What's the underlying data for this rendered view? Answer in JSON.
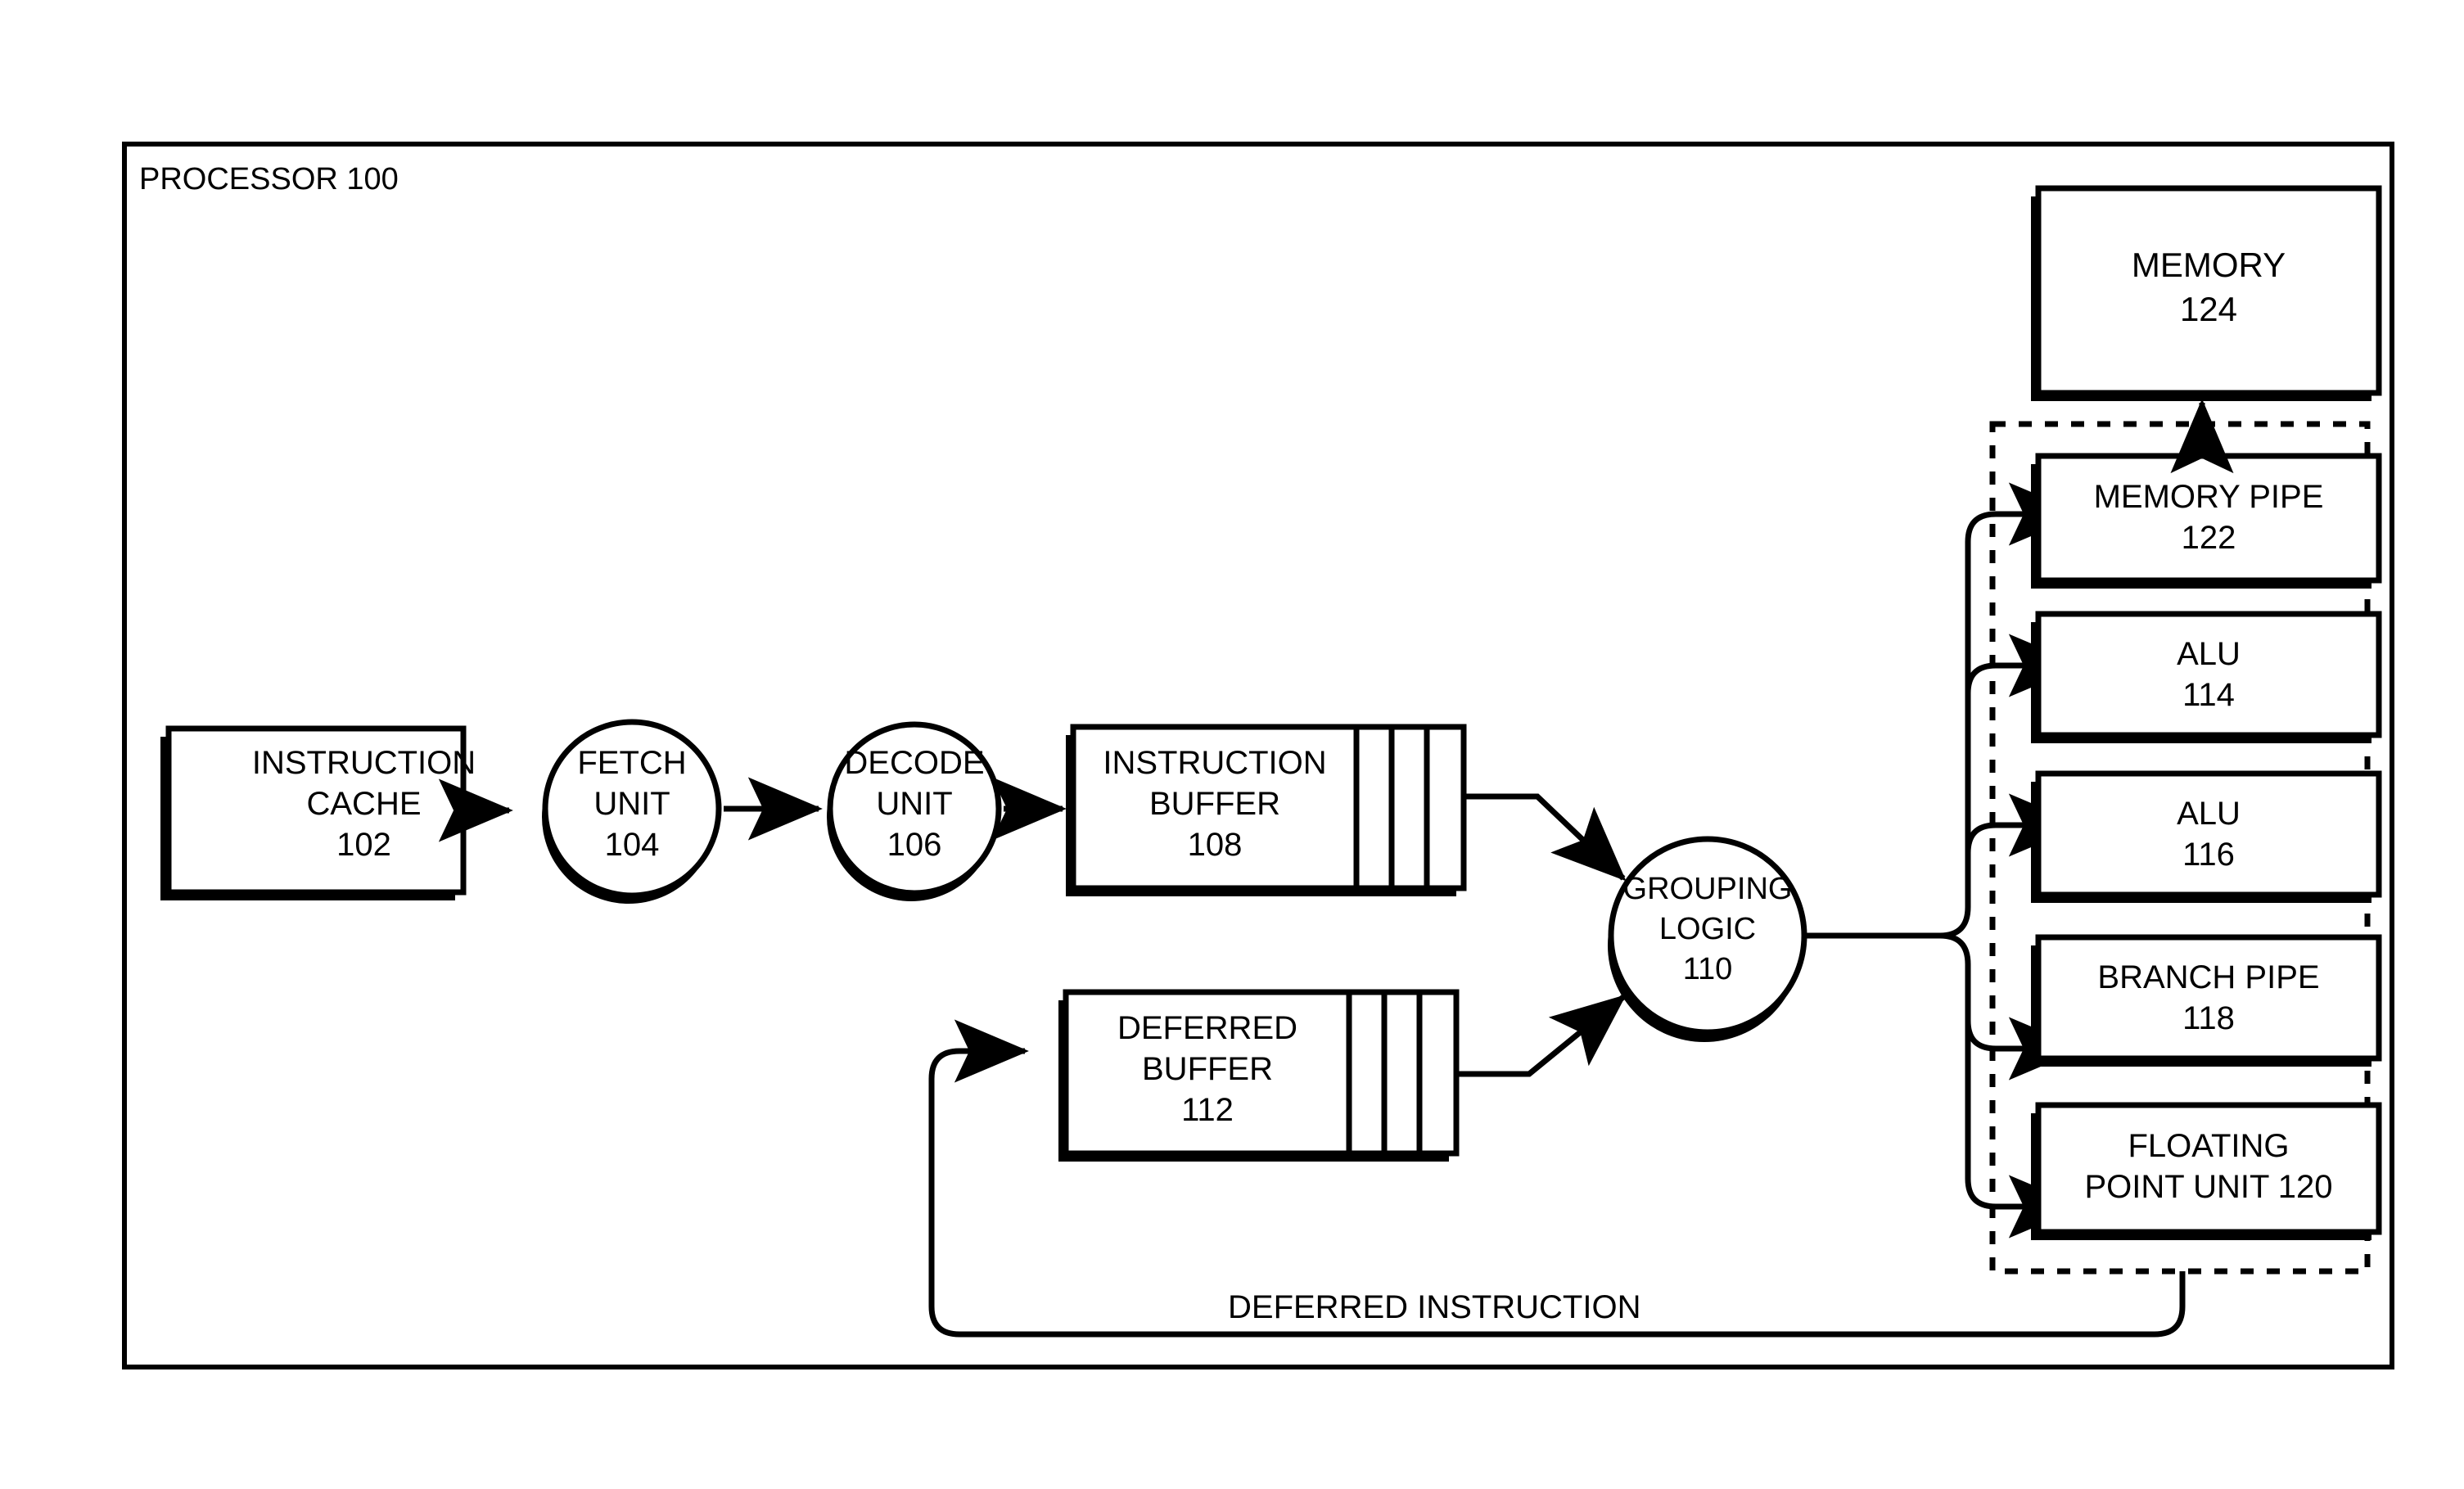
{
  "diagram": {
    "title": "PROCESSOR 100",
    "outer_block": {
      "label": "PROCESSOR 100",
      "ref": "100"
    },
    "blocks": [
      {
        "id": "instruction-cache",
        "shape": "box-shadow",
        "line1": "INSTRUCTION",
        "line2": "CACHE",
        "ref": "102"
      },
      {
        "id": "fetch-unit",
        "shape": "circle-shadow",
        "line1": "FETCH",
        "line2": "UNIT",
        "ref": "104"
      },
      {
        "id": "decode-unit",
        "shape": "circle-shadow",
        "line1": "DECODE",
        "line2": "UNIT",
        "ref": "106"
      },
      {
        "id": "instruction-buffer",
        "shape": "slotted-box-shadow",
        "line1": "INSTRUCTION",
        "line2": "BUFFER",
        "ref": "108",
        "slots": 3
      },
      {
        "id": "deferred-buffer",
        "shape": "slotted-box-shadow",
        "line1": "DEFERRED",
        "line2": "BUFFER",
        "ref": "112",
        "slots": 3
      },
      {
        "id": "grouping-logic",
        "shape": "circle-shadow",
        "line1": "GROUPING",
        "line2": "LOGIC",
        "ref": "110"
      },
      {
        "id": "memory-pipe",
        "shape": "box-shadow",
        "line1": "MEMORY PIPE",
        "ref": "122"
      },
      {
        "id": "alu-114",
        "shape": "box-shadow",
        "line1": "ALU",
        "ref": "114"
      },
      {
        "id": "alu-116",
        "shape": "box-shadow",
        "line1": "ALU",
        "ref": "116"
      },
      {
        "id": "branch-pipe",
        "shape": "box-shadow",
        "line1": "BRANCH PIPE",
        "ref": "118"
      },
      {
        "id": "floating-point-unit",
        "shape": "box-shadow",
        "line1": "FLOATING",
        "line2": "POINT UNIT  120",
        "ref": "120"
      },
      {
        "id": "memory",
        "shape": "box-shadow",
        "line1": "MEMORY",
        "ref": "124"
      }
    ],
    "group_container": {
      "id": "execution-units-group",
      "style": "dashed"
    },
    "edges": [
      {
        "from": "instruction-cache",
        "to": "fetch-unit",
        "label": ""
      },
      {
        "from": "fetch-unit",
        "to": "decode-unit",
        "label": ""
      },
      {
        "from": "decode-unit",
        "to": "instruction-buffer",
        "label": ""
      },
      {
        "from": "instruction-buffer",
        "to": "grouping-logic",
        "label": ""
      },
      {
        "from": "deferred-buffer",
        "to": "grouping-logic",
        "label": ""
      },
      {
        "from": "grouping-logic",
        "to": "memory-pipe",
        "label": ""
      },
      {
        "from": "grouping-logic",
        "to": "alu-114",
        "label": ""
      },
      {
        "from": "grouping-logic",
        "to": "alu-116",
        "label": ""
      },
      {
        "from": "grouping-logic",
        "to": "branch-pipe",
        "label": ""
      },
      {
        "from": "grouping-logic",
        "to": "floating-point-unit",
        "label": ""
      },
      {
        "from": "memory-pipe",
        "to": "memory",
        "label": ""
      },
      {
        "from": "execution-units-group",
        "to": "deferred-buffer",
        "label": "DEFERRED INSTRUCTION"
      }
    ],
    "feedback_label": "DEFERRED INSTRUCTION",
    "colors": {
      "stroke": "#000000",
      "fill": "#ffffff",
      "background": "#ffffff"
    }
  },
  "labels": {
    "processor": "PROCESSOR 100",
    "instruction_cache_l1": "INSTRUCTION",
    "instruction_cache_l2": "CACHE",
    "instruction_cache_ref": "102",
    "fetch_l1": "FETCH",
    "fetch_l2": "UNIT",
    "fetch_ref": "104",
    "decode_l1": "DECODE",
    "decode_l2": "UNIT",
    "decode_ref": "106",
    "ibuf_l1": "INSTRUCTION",
    "ibuf_l2": "BUFFER",
    "ibuf_ref": "108",
    "dbuf_l1": "DEFERRED",
    "dbuf_l2": "BUFFER",
    "dbuf_ref": "112",
    "group_l1": "GROUPING",
    "group_l2": "LOGIC",
    "group_ref": "110",
    "mempipe_l1": "MEMORY PIPE",
    "mempipe_ref": "122",
    "alu114_l1": "ALU",
    "alu114_ref": "114",
    "alu116_l1": "ALU",
    "alu116_ref": "116",
    "branch_l1": "BRANCH PIPE",
    "branch_ref": "118",
    "fpu_l1": "FLOATING",
    "fpu_l2": "POINT UNIT  120",
    "memory_l1": "MEMORY",
    "memory_ref": "124",
    "deferred_instruction": "DEFERRED INSTRUCTION"
  }
}
